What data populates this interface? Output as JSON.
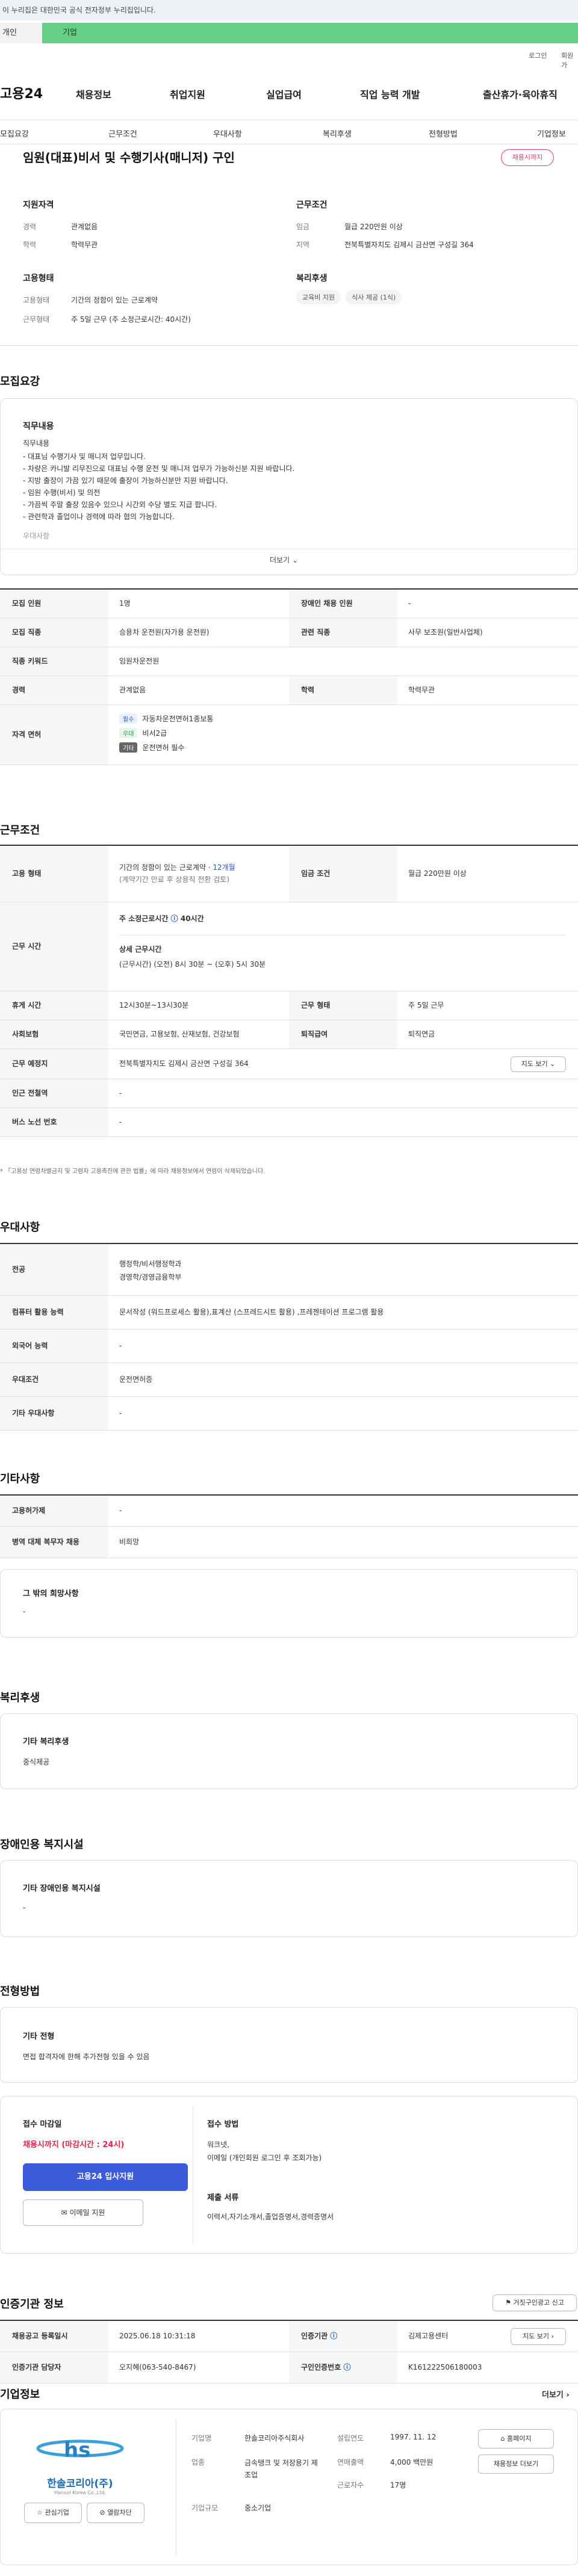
{
  "gov_notice": "이 누리집은 대한민국 공식 전자정부 누리집입니다.",
  "top_tabs": {
    "personal": "개인",
    "company": "기업"
  },
  "util": {
    "login": "로그인",
    "join": "회원가"
  },
  "logo": "고용24",
  "nav": [
    "채용정보",
    "취업지원",
    "실업급여",
    "직업 능력 개발",
    "출산휴가·육아휴직"
  ],
  "anchors": [
    "모집요강",
    "근무조건",
    "우대사항",
    "복리후생",
    "전형방법",
    "기업정보"
  ],
  "job_title": "임원(대표)비서 및 수행기사(매니저) 구인",
  "badge": "채용시까지",
  "summary": {
    "qual_heading": "지원자격",
    "career_k": "경력",
    "career_v": "관계없음",
    "edu_k": "학력",
    "edu_v": "학력무관",
    "cond_heading": "근무조건",
    "wage_k": "임금",
    "wage_v": "월급 220만원 이상",
    "region_k": "지역",
    "region_v": "전북특별자치도 김제시 금산면 구성길 364",
    "emp_heading": "고용형태",
    "emptype_v": "기간의 정함이 있는 근로계약",
    "worktype_k": "근무형태",
    "worktype_v": "주 5일 근무 (주 소정근로시간: 40시간)",
    "welfare_heading": "복리후생",
    "welfare_pills": [
      "교육비 지원",
      "식사 제공 (1식)"
    ],
    "emptype_k": "고용형태"
  },
  "recruit": {
    "section": "모집요강",
    "card_heading": "직무내용",
    "duty_title": "직무내용",
    "duty_lines": [
      "- 대표님 수행기사 및 매니저 업무입니다.",
      "- 차량은 카니발 리무진으로 대표님 수행 운전 및 매니저 업무가 가능하신분 지원 바랍니다.",
      "- 지방 출장이 가끔 있기 때문에 출장이 가능하신분만 지원 바랍니다.",
      "- 임원 수행(비서) 및 의전",
      "- 가끔씩 주말 출장 있음수 있으나 시간외 수당 별도 지급 합니다.",
      "- 관련학과 졸업이나 경력에 따라 협의 가능합니다."
    ],
    "more_line": "우대사항",
    "more_btn": "더보기",
    "rows": [
      {
        "k": "모집 인원",
        "v": "1명",
        "k2": "장애인 채용 인원",
        "v2": "-"
      },
      {
        "k": "모집 직종",
        "v": "승용차 운전원(자가용 운전원)",
        "k2": "관련 직종",
        "v2": "사무 보조원(일반사업체)"
      },
      {
        "k": "직종 키워드",
        "v": "임원차운전원"
      },
      {
        "k": "경력",
        "v": "관계없음",
        "k2": "학력",
        "v2": "학력무관"
      }
    ],
    "lic_k": "자격 면허",
    "licenses": [
      {
        "tag": "필수",
        "name": "자동차운전면허1종보통"
      },
      {
        "tag": "우대",
        "name": "비서2급"
      },
      {
        "tag": "기타",
        "name": "운전면허 필수"
      }
    ]
  },
  "conditions": {
    "section": "근무조건",
    "emp_k": "고용 형태",
    "emp_v": "기간의 정함이 있는 근로계약 · ",
    "emp_months": "12개월",
    "emp_sub": "(계약기간 만료 후 상용직 전환 검토)",
    "wage_k": "임금 조건",
    "wage_v": "월급 220만원 이상",
    "hours_k": "근무 시간",
    "hours_main": "주 소정근로시간",
    "hours_val": "40시간",
    "hours_detail_h": "상세 근무시간",
    "hours_detail": "(근무시간) (오전) 8시 30분 ~ (오후) 5시 30분",
    "break_k": "휴게 시간",
    "break_v": "12시30분~13시30분",
    "form_k": "근무 형태",
    "form_v": "주 5일 근무",
    "ins_k": "사회보험",
    "ins_v": "국민연금, 고용보험, 산재보험, 건강보험",
    "sev_k": "퇴직급여",
    "sev_v": "퇴직연금",
    "loc_k": "근무 예정지",
    "loc_v": "전북특별자치도 김제시 금산면 구성길 364",
    "map_btn": "지도 보기",
    "sub_k": "인근 전철역",
    "sub_v": "-",
    "bus_k": "버스 노선 번호",
    "bus_v": "-",
    "note": "* 「고용상 연령차별금지 및 고령자 고용촉진에 관한 법률」에 따라 채용정보에서 연령이 삭제되었습니다."
  },
  "preference": {
    "section": "우대사항",
    "rows": [
      {
        "k": "전공",
        "v": [
          "행정학/비서행정학과",
          "경영학/경영금융학부"
        ]
      },
      {
        "k": "컴퓨터 활용 능력",
        "v": [
          "문서작성 (워드프로세스 활용),표계산 (스프레드시트 활용) ,프레젠테이션 프로그램 활용"
        ]
      },
      {
        "k": "외국어 능력",
        "v": [
          "-"
        ]
      },
      {
        "k": "우대조건",
        "v": [
          "운전면허증"
        ]
      },
      {
        "k": "기타 우대사항",
        "v": [
          "-"
        ]
      }
    ]
  },
  "etc": {
    "section": "기타사항",
    "rows": [
      {
        "k": "고용허가제",
        "v": "-"
      },
      {
        "k": "병역 대체 복무자 채용",
        "v": "비희망"
      }
    ],
    "wish_h": "그 밖의 희망사항",
    "wish_v": "-"
  },
  "welfare": {
    "section": "복리후생",
    "h": "기타 복리후생",
    "v": "중식제공"
  },
  "disabled": {
    "section": "장애인용 복지시설",
    "h": "기타 장애인용 복지시설",
    "v": "-"
  },
  "selection": {
    "section": "전형방법",
    "h": "기타 전형",
    "v": "면접 합격자에 한해 추가전형 있을 수 있음"
  },
  "apply": {
    "deadline_h": "접수 마감일",
    "deadline_v": "채용시까지 (마감시간 : 24시)",
    "apply_btn": "고용24 입사지원",
    "email_btn": "이메일 지원",
    "method_h": "접수 방법",
    "methods": [
      "워크넷,",
      "이메일 (개인회원 로그인 후 조회가능)"
    ],
    "docs_h": "제출 서류",
    "docs_v": "이력서,자기소개서,졸업증명서,경력증명서"
  },
  "agency": {
    "section": "인증기관 정보",
    "report_btn": "거짓구인광고 신고",
    "reg_k": "채용공고 등록일시",
    "reg_v": "2025.06.18 10:31:18",
    "agency_k": "인증기관",
    "agency_v": "김제고용센터",
    "map_btn": "지도 보기",
    "mgr_k": "인증기관 담당자",
    "mgr_v": "오지혜(063-540-8467)",
    "num_k": "구인인증번호",
    "num_v": "K161222506180003"
  },
  "company": {
    "section": "기업정보",
    "more": "더보기",
    "logo_text": "한솔코리아(주)",
    "logo_sub": "Hansol Korea Co.,Ltd.",
    "fav_btn": "관심기업",
    "block_btn": "열람차단",
    "fields": [
      {
        "k": "기업명",
        "v": "한솔코리아주식회사"
      },
      {
        "k": "업종",
        "v": "금속탱크 및 저장용기 제조업"
      },
      {
        "k": "기업규모",
        "v": "중소기업"
      }
    ],
    "fields2": [
      {
        "k": "설립연도",
        "v": "1997. 11. 12"
      },
      {
        "k": "연매출액",
        "v": "4,000 백만원"
      },
      {
        "k": "근로자수",
        "v": "17명"
      }
    ],
    "homepage_btn": "홈페이지",
    "jobs_btn": "채용정보 더보기"
  }
}
